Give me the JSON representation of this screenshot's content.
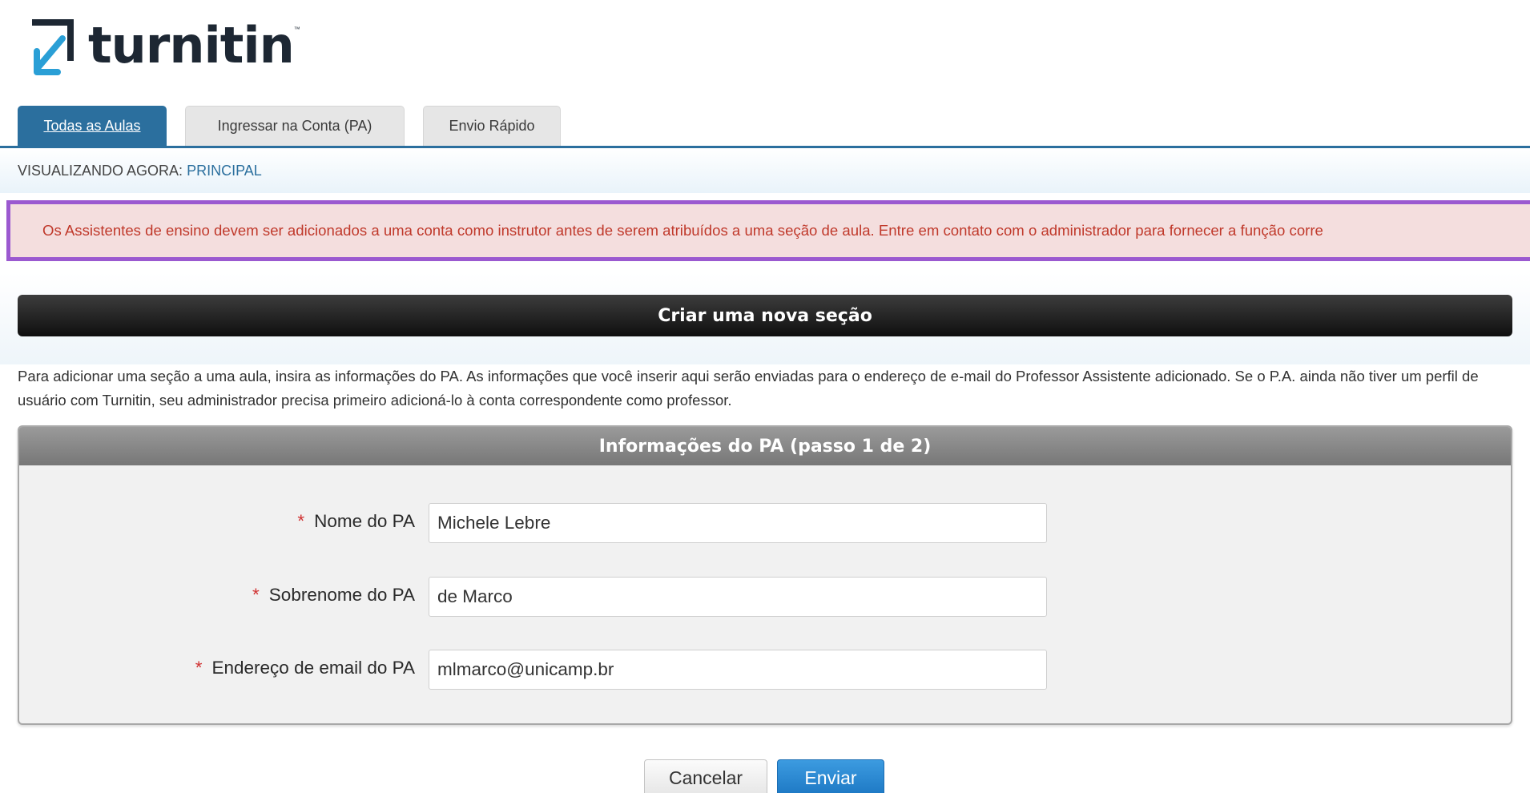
{
  "brand": {
    "name": "turnitin",
    "trademark": "™"
  },
  "tabs": [
    {
      "label": "Todas as Aulas",
      "active": true
    },
    {
      "label": "Ingressar na Conta (PA)",
      "active": false
    },
    {
      "label": "Envio Rápido",
      "active": false
    }
  ],
  "viewing": {
    "label": "VISUALIZANDO AGORA:",
    "value": "PRINCIPAL"
  },
  "alert": {
    "text": "Os Assistentes de ensino devem ser adicionados a uma conta como instrutor antes de serem atribuídos a uma seção de aula. Entre em contato com o administrador para fornecer a função corre"
  },
  "section": {
    "title": "Criar uma nova seção"
  },
  "description": {
    "text": "Para adicionar uma seção a uma aula, insira as informações do PA. As informações que você inserir aqui serão enviadas para o endereço de e-mail do Professor Assistente adicionado. Se o P.A. ainda não tiver um perfil de usuário com Turnitin, seu administrador precisa primeiro adicioná-lo à conta correspondente como professor."
  },
  "form": {
    "title": "Informações do PA (passo 1 de 2)",
    "required_marker": "*",
    "fields": [
      {
        "label": "Nome do PA",
        "value": "Michele Lebre"
      },
      {
        "label": "Sobrenome do PA",
        "value": "de Marco"
      },
      {
        "label": "Endereço de email do PA",
        "value": "mlmarco@unicamp.br"
      }
    ]
  },
  "actions": {
    "cancel_label": "Cancelar",
    "submit_label": "Enviar"
  },
  "colors": {
    "tab_active": "#2b6f9e",
    "alert_border": "#9b59d0",
    "alert_background": "#f4dede",
    "alert_text": "#c0392b",
    "submit_button": "#1d78c4"
  },
  "icons": {
    "logo": "turnitin-arrow-logo-icon"
  }
}
